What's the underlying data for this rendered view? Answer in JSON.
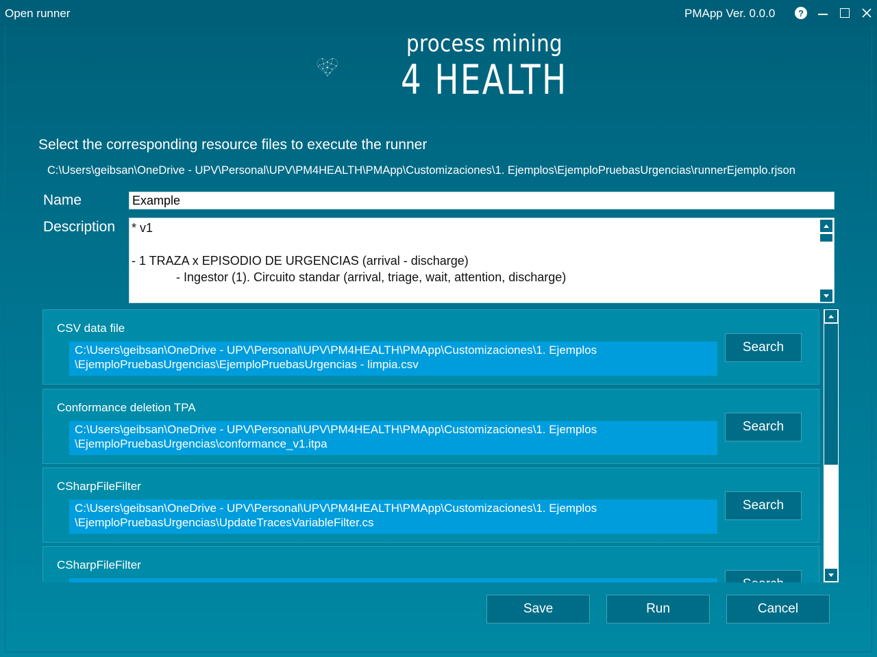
{
  "window": {
    "title": "Open runner",
    "version": "PMApp Ver. 0.0.0",
    "help_glyph": "?",
    "close_glyph": "✕"
  },
  "logo": {
    "line1": "process mining",
    "line2": "4 HEALTH"
  },
  "header": {
    "instruction": "Select the corresponding resource files to execute the runner",
    "runner_path": "C:\\Users\\geibsan\\OneDrive - UPV\\Personal\\UPV\\PM4HEALTH\\PMApp\\Customizaciones\\1. Ejemplos\\EjemploPruebasUrgencias\\runnerEjemplo.rjson"
  },
  "form": {
    "name_label": "Name",
    "name_value": "Example",
    "description_label": "Description",
    "description_value": "* v1\n\n- 1 TRAZA x EPISODIO DE URGENCIAS (arrival - discharge)\n             - Ingestor (1). Circuito standar (arrival, triage, wait, attention, discharge)"
  },
  "resources": [
    {
      "title": "CSV data file",
      "path": "C:\\Users\\geibsan\\OneDrive - UPV\\Personal\\UPV\\PM4HEALTH\\PMApp\\Customizaciones\\1. Ejemplos\n\\EjemploPruebasUrgencias\\EjemploPruebasUrgencias - limpia.csv",
      "button": "Search"
    },
    {
      "title": "Conformance deletion TPA",
      "path": "C:\\Users\\geibsan\\OneDrive - UPV\\Personal\\UPV\\PM4HEALTH\\PMApp\\Customizaciones\\1. Ejemplos\n\\EjemploPruebasUrgencias\\conformance_v1.itpa",
      "button": "Search"
    },
    {
      "title": "CSharpFileFilter",
      "path": "C:\\Users\\geibsan\\OneDrive - UPV\\Personal\\UPV\\PM4HEALTH\\PMApp\\Customizaciones\\1. Ejemplos\n\\EjemploPruebasUrgencias\\UpdateTracesVariableFilter.cs",
      "button": "Search"
    },
    {
      "title": "CSharpFileFilter",
      "path": "",
      "button": "Search"
    }
  ],
  "footer": {
    "save": "Save",
    "run": "Run",
    "cancel": "Cancel"
  },
  "colors": {
    "background": "#00738f",
    "titlebar": "#005f78",
    "card": "#008ca8",
    "path_field": "#009ddd",
    "button": "#006d88"
  }
}
